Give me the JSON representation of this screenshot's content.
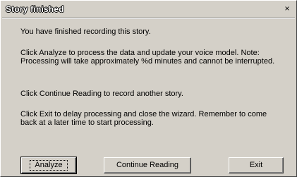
{
  "window": {
    "title": "Story finished",
    "close_glyph": "×"
  },
  "messages": [
    "You have finished recording this story.",
    "Click Analyze to process the data and update your voice model. Note: Processing will take approximately %d minutes and cannot be interrupted.",
    "Click Continue Reading to record another story.",
    "Click Exit to delay processing and close the wizard. Remember to come back at a later time to start processing."
  ],
  "buttons": {
    "analyze": "Analyze",
    "continue_reading": "Continue Reading",
    "exit": "Exit"
  }
}
